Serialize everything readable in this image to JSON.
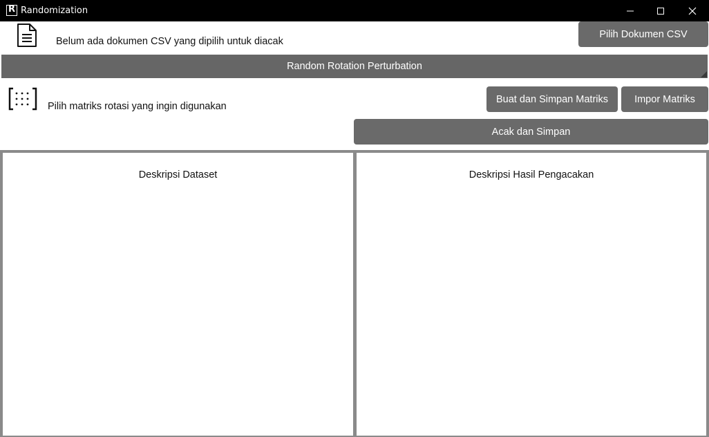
{
  "window": {
    "title": "Randomization",
    "app_icon_letter": "R",
    "icons": [
      "minimize-icon",
      "maximize-icon",
      "close-icon"
    ]
  },
  "document": {
    "status": "Belum ada dokumen CSV yang dipilih untuk diacak",
    "pick_button": "Pilih Dokumen CSV",
    "icon": "document-icon"
  },
  "section": {
    "title": "Random Rotation Perturbation"
  },
  "matrix": {
    "prompt": "Pilih matriks rotasi yang ingin digunakan",
    "create_button": "Buat dan Simpan Matriks",
    "import_button": "Impor Matriks",
    "icon": "matrix-icon"
  },
  "actions": {
    "shuffle_button": "Acak dan Simpan"
  },
  "panels": {
    "dataset_title": "Deskripsi Dataset",
    "result_title": "Deskripsi Hasil Pengacakan"
  },
  "colors": {
    "titlebar": "#000000",
    "button": "#6a6a6a",
    "section_bar": "#666666",
    "panel_border": "#8a8a8a"
  }
}
